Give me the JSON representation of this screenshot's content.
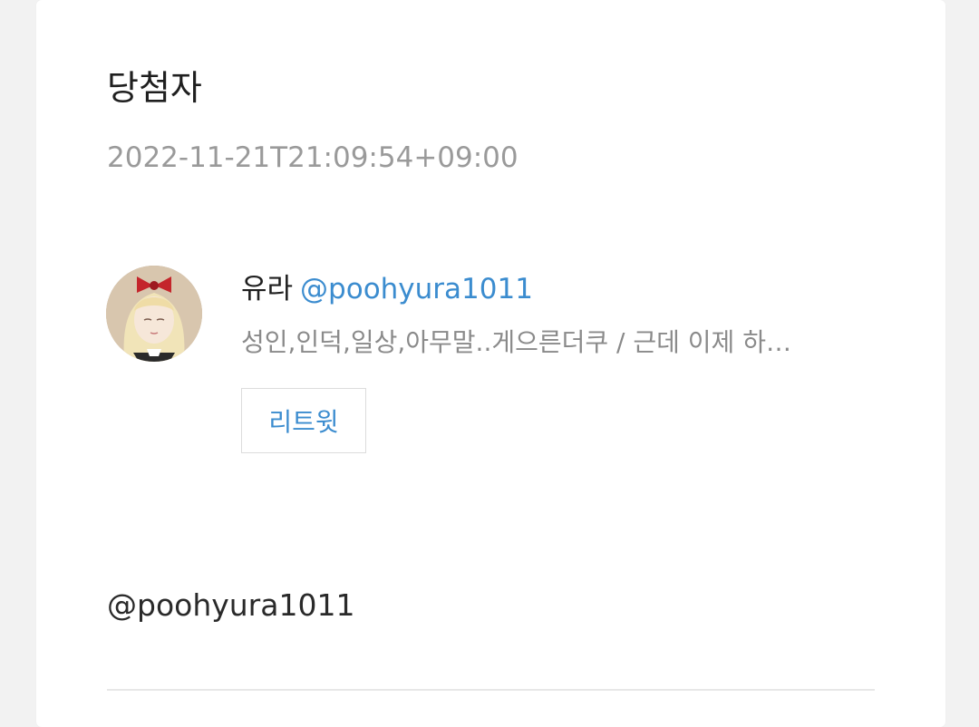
{
  "post": {
    "title": "당첨자",
    "timestamp": "2022-11-21T21:09:54+09:00"
  },
  "user": {
    "name": "유라",
    "handle": "@poohyura1011",
    "bio": "성인,인덕,일상,아무말..게으른더쿠 / 근데 이제 하…",
    "avatar_icon": "doll-avatar-icon",
    "retweet_label": "리트윗"
  },
  "content": {
    "mention": "@poohyura1011"
  },
  "colors": {
    "accent": "#3b8ccf",
    "muted": "#9a9a9a",
    "background": "#f2f2f2"
  }
}
